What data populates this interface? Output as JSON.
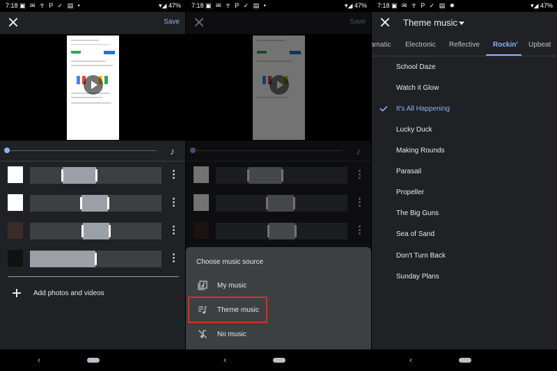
{
  "status_bar": {
    "time": "7:18",
    "battery": "47%",
    "notif_icons": "▣ ✉ ☥ P ✓ ▤ •",
    "notif_icons_p3": "▣ ✉ ☥ P ✓ ▤ ✸"
  },
  "editor": {
    "save_label": "Save",
    "add_label": "Add photos and videos",
    "clips_count": 4
  },
  "music_sheet": {
    "title": "Choose music source",
    "options": [
      "My music",
      "Theme music",
      "No music"
    ],
    "highlighted": "Theme music"
  },
  "theme_music": {
    "title": "Theme music",
    "tabs": [
      "amatic",
      "Electronic",
      "Reflective",
      "Rockin'",
      "Upbeat"
    ],
    "active_tab": "Rockin'",
    "songs": [
      "School Daze",
      "Watch it Glow",
      "It's All Happening",
      "Lucky Duck",
      "Making Rounds",
      "Parasail",
      "Propeller",
      "The Big Guns",
      "Sea of Sand",
      "Don't Turn Back",
      "Sunday Plans"
    ],
    "selected_song": "It's All Happening"
  },
  "colors": {
    "accent": "#8ab4f8",
    "highlight_border": "#d93025",
    "background": "#202124"
  }
}
